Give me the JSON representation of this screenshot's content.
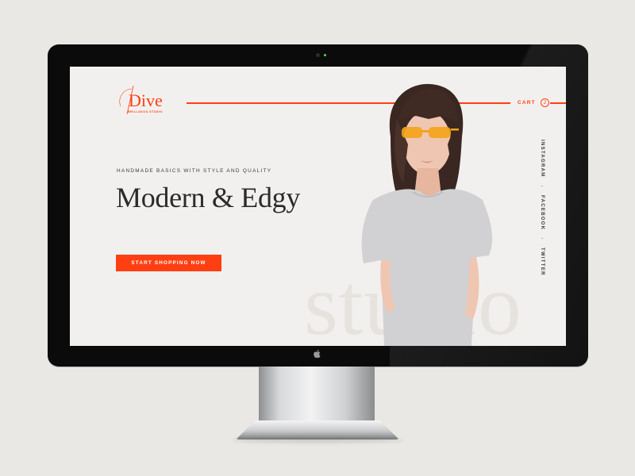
{
  "brand": {
    "name": "Dive",
    "subtitle": "BRILLAKOU STUDIO",
    "accent": "#ff3f12"
  },
  "header": {
    "cart_label": "CART",
    "cart_count": "2"
  },
  "hero": {
    "tagline": "HANDMADE BASICS WITH STYLE AND QUALITY",
    "headline": "Modern & Edgy",
    "cta_label": "START SHOPPING NOW",
    "watermark": "studio"
  },
  "social": {
    "items": [
      "INSTAGRAM",
      "FACEBOOK",
      "TWITTER"
    ],
    "separator": "-"
  },
  "icons": {
    "apple": "apple-logo-icon",
    "camera": "camera-icon"
  }
}
